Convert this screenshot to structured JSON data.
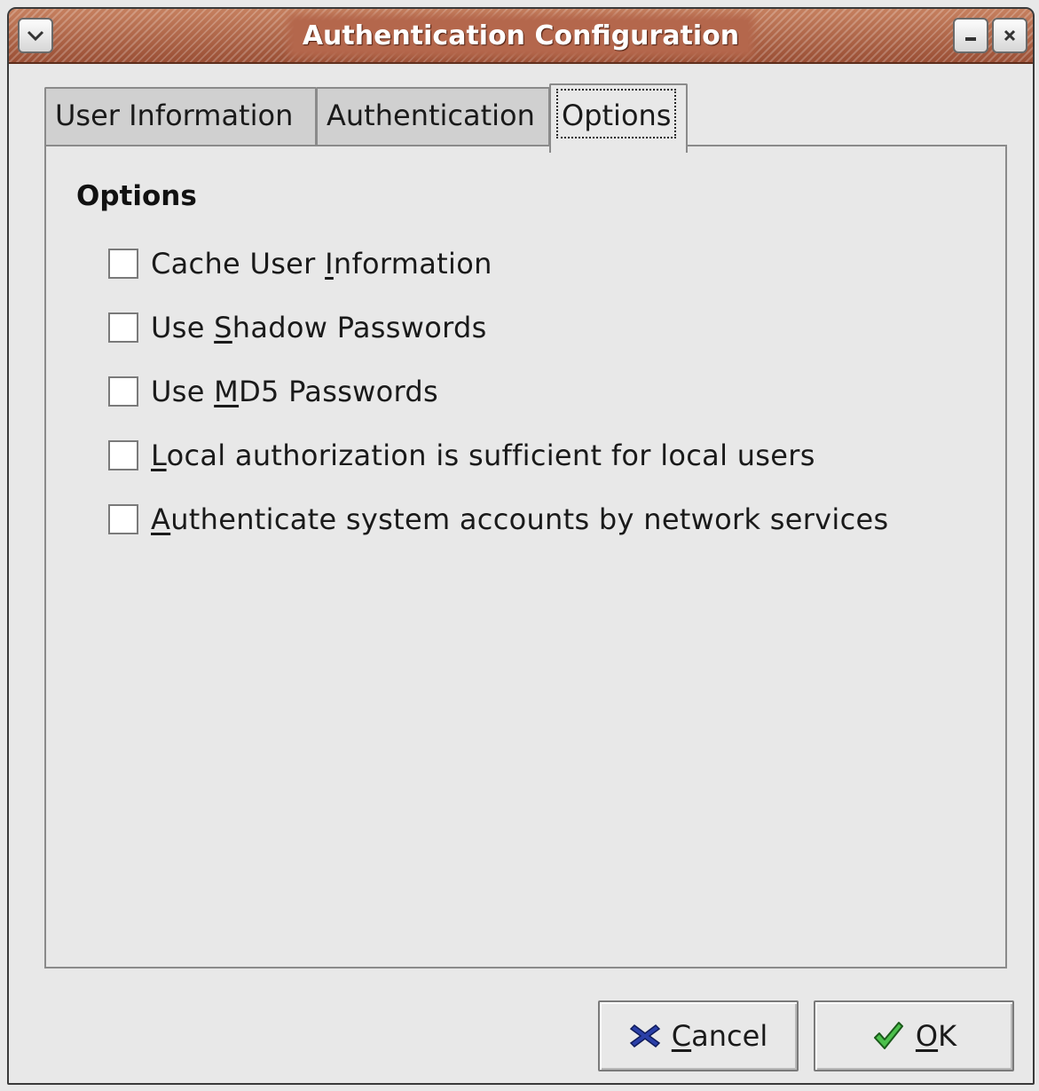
{
  "window": {
    "title": "Authentication Configuration"
  },
  "tabs": [
    {
      "label": "User Information",
      "active": false
    },
    {
      "label": "Authentication",
      "active": false
    },
    {
      "label": "Options",
      "active": true
    }
  ],
  "options_panel": {
    "section_title": "Options",
    "checkboxes": [
      {
        "pre": "Cache User ",
        "mnemonic": "I",
        "post": "nformation",
        "checked": false
      },
      {
        "pre": "Use ",
        "mnemonic": "S",
        "post": "hadow Passwords",
        "checked": false
      },
      {
        "pre": "Use ",
        "mnemonic": "M",
        "post": "D5 Passwords",
        "checked": false
      },
      {
        "pre": "",
        "mnemonic": "L",
        "post": "ocal authorization is sufficient for local users",
        "checked": false
      },
      {
        "pre": "",
        "mnemonic": "A",
        "post": "uthenticate system accounts by network services",
        "checked": false
      }
    ]
  },
  "buttons": {
    "cancel": {
      "mnemonic": "C",
      "rest": "ancel",
      "icon": "cancel-x-icon"
    },
    "ok": {
      "mnemonic": "O",
      "rest": "K",
      "icon": "checkmark-icon"
    }
  },
  "colors": {
    "titlebar": "#b4674c",
    "window_bg": "#e8e8e8",
    "cancel_icon": "#2a3fa8",
    "ok_icon": "#3aa83a"
  }
}
